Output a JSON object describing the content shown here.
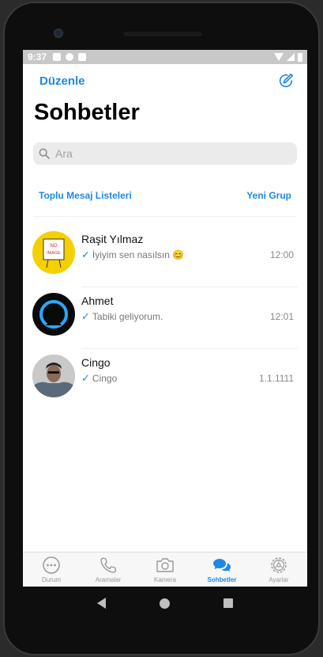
{
  "status": {
    "time": "9:37"
  },
  "header": {
    "edit_label": "Düzenle",
    "title": "Sohbetler"
  },
  "search": {
    "placeholder": "Ara"
  },
  "links": {
    "broadcast": "Toplu Mesaj Listeleri",
    "new_group": "Yeni Grup"
  },
  "chats": [
    {
      "name": "Raşit Yılmaz",
      "message": "İyiyim sen nasılsın 😊",
      "time": "12:00",
      "avatar_text": "NO IMAGE"
    },
    {
      "name": "Ahmet",
      "message": "Tabiki geliyorum.",
      "time": "12:01"
    },
    {
      "name": "Cingo",
      "message": "Cingo",
      "time": "1.1.1111"
    }
  ],
  "tabs": [
    {
      "label": "Durum",
      "icon": "status-icon"
    },
    {
      "label": "Aramalar",
      "icon": "phone-icon"
    },
    {
      "label": "Kamera",
      "icon": "camera-icon"
    },
    {
      "label": "Sohbetler",
      "icon": "chat-bubbles-icon",
      "active": true
    },
    {
      "label": "Ayarlar",
      "icon": "settings-gear-icon"
    }
  ],
  "colors": {
    "accent": "#1e88e5",
    "inactive": "#999999"
  }
}
